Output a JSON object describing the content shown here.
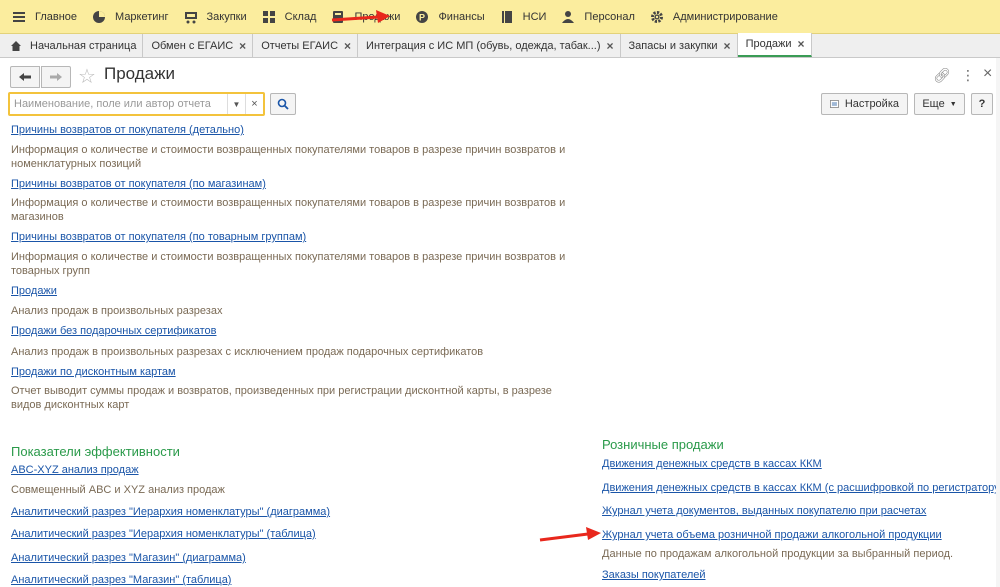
{
  "sections": [
    {
      "label": "Главное",
      "icon": "menu-icon"
    },
    {
      "label": "Маркетинг",
      "icon": "pie-chart-icon"
    },
    {
      "label": "Закупки",
      "icon": "cart-icon"
    },
    {
      "label": "Склад",
      "icon": "warehouse-icon"
    },
    {
      "label": "Продажи",
      "icon": "sales-icon"
    },
    {
      "label": "Финансы",
      "icon": "ruble-icon"
    },
    {
      "label": "НСИ",
      "icon": "book-icon"
    },
    {
      "label": "Персонал",
      "icon": "person-icon"
    },
    {
      "label": "Администрирование",
      "icon": "gear-icon"
    }
  ],
  "tabs": [
    {
      "label": "Начальная страница",
      "icon": "home-icon"
    },
    {
      "label": "Обмен с ЕГАИС",
      "close": "×"
    },
    {
      "label": "Отчеты ЕГАИС",
      "close": "×"
    },
    {
      "label": "Интеграция с ИС МП (обувь, одежда, табак...)",
      "close": "×"
    },
    {
      "label": "Запасы и закупки",
      "close": "×"
    },
    {
      "label": "Продажи",
      "close": "×",
      "active": true
    }
  ],
  "form": {
    "title": "Продажи",
    "search_placeholder": "Наименование, поле или автор отчета",
    "settings_label": "Настройка",
    "more_label": "Еще",
    "help_label": "?"
  },
  "reports": [
    {
      "title": "Причины возвратов от покупателя (детально)",
      "desc": "Информация о количестве и стоимости возвращенных покупателями товаров в разрезе причин возвратов и номенклатурных позиций"
    },
    {
      "title": "Причины возвратов от покупателя (по магазинам)",
      "desc": "Информация о количестве и стоимости возвращенных покупателями товаров в разрезе причин возвратов и магазинов"
    },
    {
      "title": "Причины возвратов от покупателя (по товарным группам)",
      "desc": "Информация о количестве и стоимости возвращенных покупателями товаров в разрезе причин возвратов и товарных групп"
    },
    {
      "title": "Продажи",
      "desc": "Анализ продаж в произвольных разрезах"
    },
    {
      "title": "Продажи без подарочных сертификатов",
      "desc": "Анализ продаж в произвольных разрезах с исключением продаж подарочных сертификатов"
    },
    {
      "title": "Продажи по дисконтным картам",
      "desc": "Отчет выводит суммы продаж и возвратов, произведенных при регистрации дисконтной карты, в разрезе видов дисконтных карт"
    }
  ],
  "efficiency": {
    "title": "Показатели эффективности",
    "items": [
      {
        "title": "ABC-XYZ анализ продаж",
        "desc": "Совмещенный ABC и XYZ анализ продаж"
      },
      {
        "title": "Аналитический разрез \"Иерархия номенклатуры\" (диаграмма)"
      },
      {
        "title": "Аналитический разрез \"Иерархия номенклатуры\" (таблица)"
      },
      {
        "title": "Аналитический разрез \"Магазин\" (диаграмма)"
      },
      {
        "title": "Аналитический разрез \"Магазин\" (таблица)"
      }
    ]
  },
  "retail": {
    "title": "Розничные продажи",
    "items": [
      {
        "title": "Движения денежных средств в кассах ККМ"
      },
      {
        "title": "Движения денежных средств в кассах ККМ (с расшифровкой по регистратору)"
      },
      {
        "title": "Журнал учета документов, выданных покупателю при расчетах"
      },
      {
        "title": "Журнал учета объема розничной продажи алкогольной продукции",
        "desc": "Данные по продажам алкогольной продукции за выбранный период."
      },
      {
        "title": "Заказы покупателей"
      }
    ]
  },
  "colors": {
    "accent_green": "#2a9a4a",
    "link_blue": "#1a55a8",
    "topbar_yellow": "#fbed9e",
    "arrow_red": "#e8271c"
  }
}
